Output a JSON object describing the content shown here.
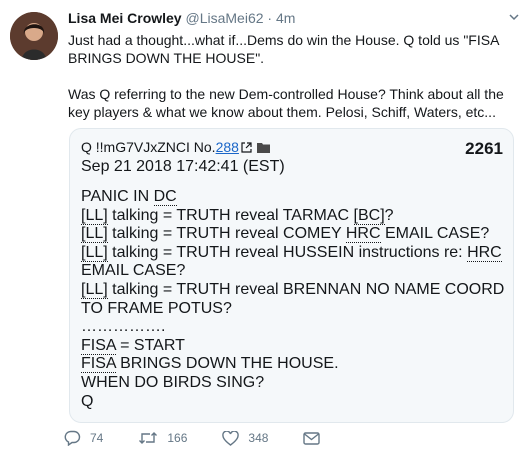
{
  "tweet": {
    "display_name": "Lisa Mei Crowley",
    "handle": "@LisaMei62",
    "separator": "·",
    "time": "4m",
    "text_p1": "Just had a thought...what if...Dems do win the House. Q told us \"FISA BRINGS DOWN THE HOUSE\".",
    "text_p2": "Was Q referring to the new Dem-controlled House? Think about all the key players & what we know about them. Pelosi, Schiff, Waters, etc..."
  },
  "card": {
    "q_id": "Q !!mG7VJxZNCI No.",
    "q_no": "288",
    "post_number": "2261",
    "date": "Sep 21 2018 17:42:41 (EST)",
    "lines": {
      "l1a": "PANIC IN ",
      "l1b": "DC",
      "ll": "[LL]",
      "talk": " talking = TRUTH reveal TARMAC ",
      "bc": "[BC]",
      "q_mark": "?",
      "l3a": " talking = TRUTH reveal COMEY ",
      "hrc": "HRC",
      "l3b": " EMAIL CASE?",
      "l4a": " talking = TRUTH reveal HUSSEIN instructions re: ",
      "l5": "EMAIL CASE?",
      "l6a": " talking = TRUTH reveal BRENNAN NO NAME COORD",
      "l7": "TO FRAME POTUS?",
      "dots": "…………….",
      "fisa": "FISA",
      "l9b": " = START",
      "l10b": " BRINGS DOWN THE HOUSE.",
      "l11": "WHEN DO BIRDS SING?",
      "l12": "Q"
    }
  },
  "actions": {
    "replies": "74",
    "retweets": "166",
    "likes": "348"
  },
  "colors": {
    "link": "#1a66c8",
    "muted": "#657786",
    "card_bg": "#f5f8fa",
    "border": "#e1e8ed"
  }
}
